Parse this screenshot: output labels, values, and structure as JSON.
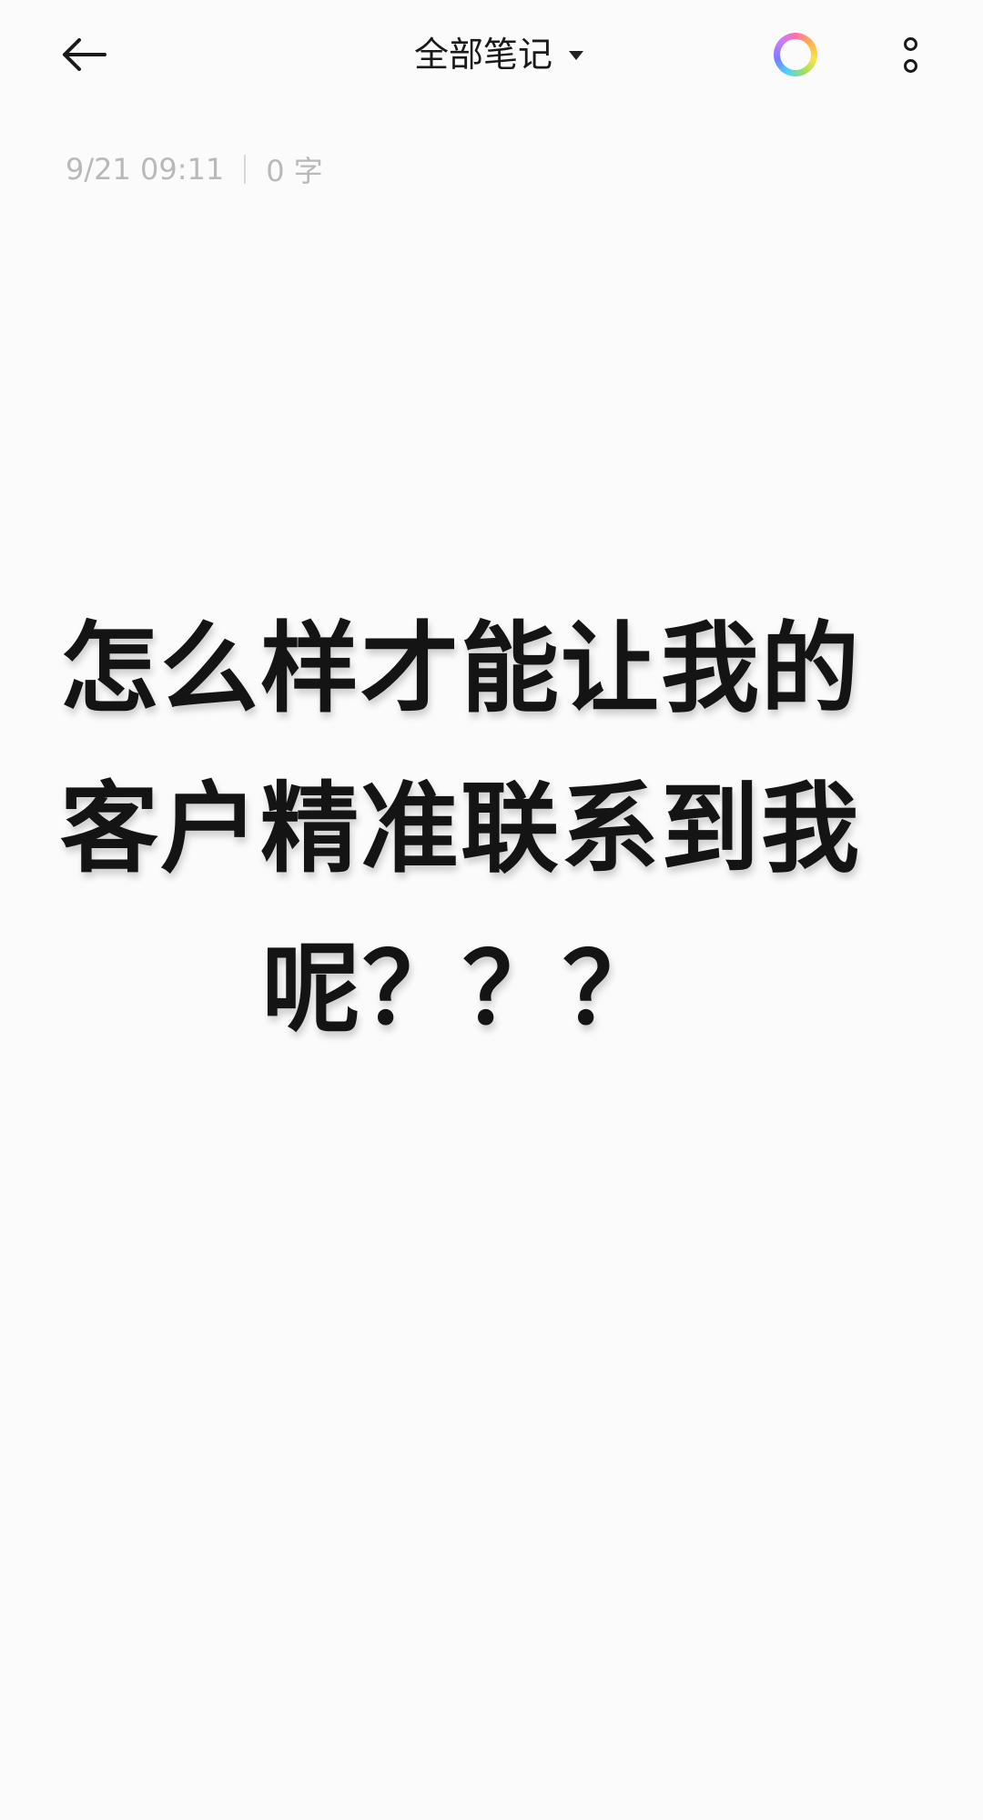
{
  "header": {
    "title": "全部笔记",
    "icons": {
      "back": "back-arrow-icon",
      "dropdown": "caret-down-icon",
      "color": "color-ring-icon",
      "more": "more-vertical-icon"
    }
  },
  "meta": {
    "datetime": "9/21 09:11",
    "word_count": "0 字"
  },
  "note": {
    "lines": [
      "怎么样才能让我的",
      "客户精准联系到我",
      "呢？？？"
    ]
  }
}
